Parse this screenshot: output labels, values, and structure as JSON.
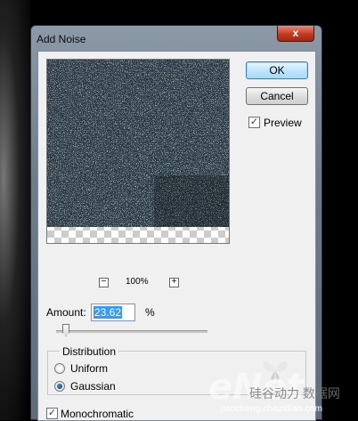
{
  "window": {
    "title": "Add Noise",
    "close_label": "x"
  },
  "buttons": {
    "ok_label": "OK",
    "cancel_label": "Cancel"
  },
  "preview": {
    "checkbox_label": "Preview",
    "checked": true,
    "zoom_out": "−",
    "zoom_in": "+",
    "zoom_level": "100%"
  },
  "amount": {
    "label": "Amount:",
    "value": "23.62",
    "unit": "%",
    "slider_fraction": 0.0
  },
  "distribution": {
    "title": "Distribution",
    "options": [
      {
        "label": "Uniform",
        "selected": false
      },
      {
        "label": "Gaussian",
        "selected": true
      }
    ]
  },
  "monochromatic": {
    "label": "Monochromatic",
    "checked": true
  },
  "watermark": {
    "logo": "eNet",
    "text": "硅谷动力 数据网",
    "url": "jiaocheng.chazidian.com"
  }
}
